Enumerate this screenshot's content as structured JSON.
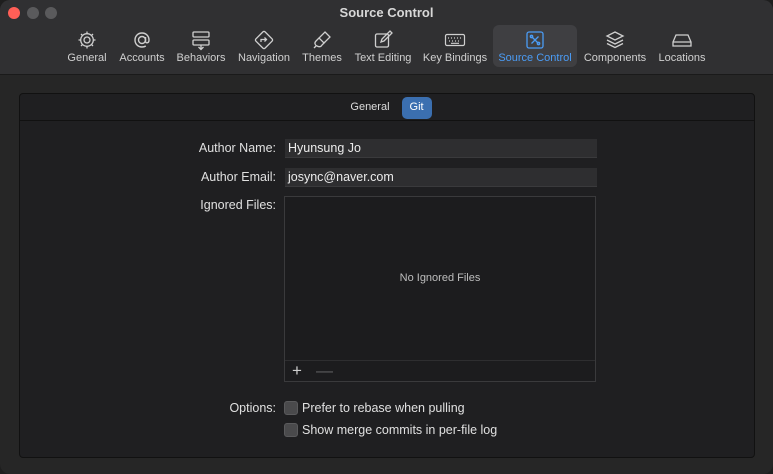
{
  "window": {
    "title": "Source Control"
  },
  "toolbar": {
    "tabs": [
      {
        "label": "General",
        "icon": "gear-icon"
      },
      {
        "label": "Accounts",
        "icon": "at-icon"
      },
      {
        "label": "Behaviors",
        "icon": "behaviors-icon"
      },
      {
        "label": "Navigation",
        "icon": "navigation-icon"
      },
      {
        "label": "Themes",
        "icon": "brush-icon"
      },
      {
        "label": "Text Editing",
        "icon": "edit-icon"
      },
      {
        "label": "Key Bindings",
        "icon": "keyboard-icon"
      },
      {
        "label": "Source Control",
        "icon": "source-control-icon",
        "active": true
      },
      {
        "label": "Components",
        "icon": "layers-icon"
      },
      {
        "label": "Locations",
        "icon": "drive-icon"
      }
    ],
    "active_color": "#4b9cf5"
  },
  "segments": {
    "general": "General",
    "git": "Git",
    "selected": "Git"
  },
  "form": {
    "author_name_label": "Author Name:",
    "author_name_value": "Hyunsung Jo",
    "author_email_label": "Author Email:",
    "author_email_value": "josync@naver.com",
    "ignored_files_label": "Ignored Files:",
    "ignored_files_empty": "No Ignored Files",
    "add_symbol": "+",
    "remove_symbol": "—",
    "options_label": "Options:",
    "option_rebase": "Prefer to rebase when pulling",
    "option_merge_commits": "Show merge commits in per-file log"
  }
}
